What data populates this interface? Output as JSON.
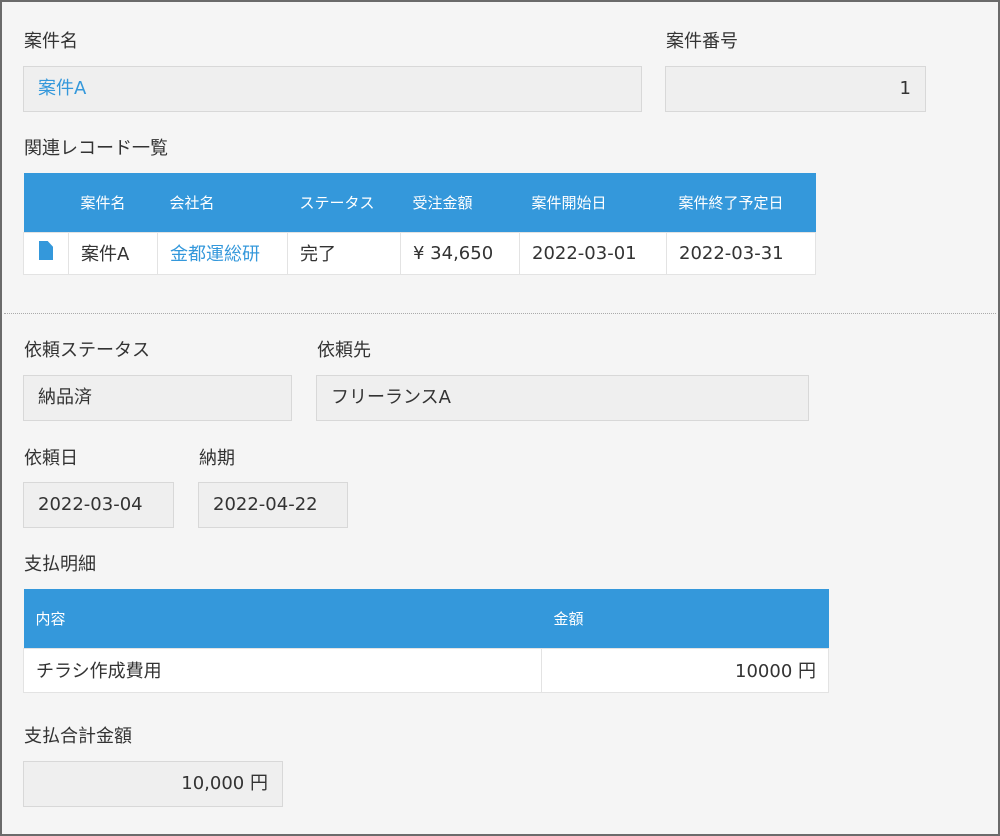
{
  "case_name": {
    "label": "案件名",
    "value": "案件A"
  },
  "case_number": {
    "label": "案件番号",
    "value": "1"
  },
  "related_records": {
    "label": "関連レコード一覧",
    "headers": [
      "案件名",
      "会社名",
      "ステータス",
      "受注金額",
      "案件開始日",
      "案件終了予定日"
    ],
    "rows": [
      {
        "icon": "document-icon",
        "case_name": "案件A",
        "company": "金都運総研",
        "status": "完了",
        "amount": "¥ 34,650",
        "start_date": "2022-03-01",
        "end_date": "2022-03-31"
      }
    ]
  },
  "request_status": {
    "label": "依頼ステータス",
    "value": "納品済"
  },
  "request_to": {
    "label": "依頼先",
    "value": "フリーランスA"
  },
  "request_date": {
    "label": "依頼日",
    "value": "2022-03-04"
  },
  "due_date": {
    "label": "納期",
    "value": "2022-04-22"
  },
  "payment_details": {
    "label": "支払明細",
    "headers": [
      "内容",
      "金額"
    ],
    "rows": [
      {
        "content": "チラシ作成費用",
        "amount": "10000 円"
      }
    ]
  },
  "payment_total": {
    "label": "支払合計金額",
    "value": "10,000 円"
  },
  "colors": {
    "accent": "#3498db",
    "field_bg": "#efefef",
    "page_bg": "#f5f5f5"
  }
}
